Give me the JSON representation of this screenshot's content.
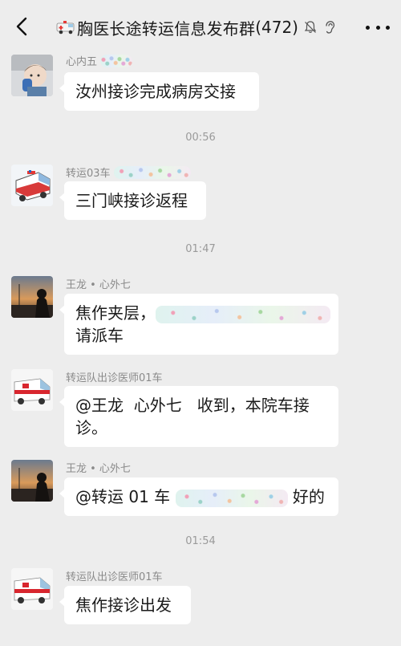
{
  "header": {
    "title": "胸医长途转运信息发布群",
    "count": "(472)"
  },
  "messages": [
    {
      "sender": "心内五",
      "text": "汝州接诊完成病房交接",
      "avatar": "baby-photo"
    },
    {
      "time": "00:56"
    },
    {
      "sender": "转运03车",
      "text": "三门峡接诊返程",
      "avatar": "ambulance-cartoon"
    },
    {
      "time": "01:47"
    },
    {
      "sender": "王龙 • 心外七",
      "text_line1": "焦作夹层，",
      "text_line2": "请派车",
      "avatar": "sunset-photo"
    },
    {
      "sender": "转运队出诊医师01车",
      "text_line1": "@王龙  心外七   收到，本院车接",
      "text_line2": "诊。",
      "avatar": "ambulance-photo"
    },
    {
      "sender": "王龙 • 心外七",
      "text_prefix": "@转运 01 车",
      "text_suffix": "好的",
      "avatar": "sunset-photo"
    },
    {
      "time": "01:54"
    },
    {
      "sender": "转运队出诊医师01车",
      "text": "焦作接诊出发",
      "avatar": "ambulance-photo"
    }
  ],
  "icons": {
    "back": "chevron-left-icon",
    "mute": "bell-off-icon",
    "ear": "ear-icon",
    "more": "more-dots-icon"
  }
}
